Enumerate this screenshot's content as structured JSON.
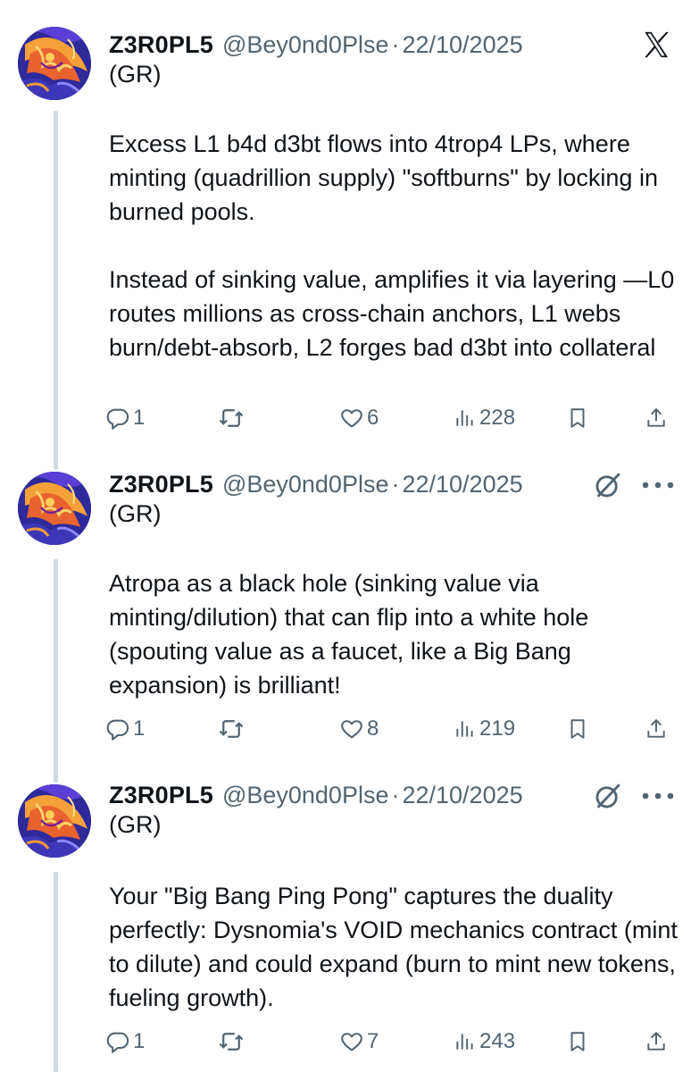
{
  "tweets": [
    {
      "name": "Z3R0PL5",
      "handle": "@Bey0nd0Plse",
      "separator": "·",
      "date": "22/10/2025",
      "subname": "(GR)",
      "paragraphs": [
        "Excess L1 b4d d3bt flows into 4trop4 LPs, where minting (quadrillion supply) \"softburns\" by locking in burned pools.",
        "Instead of sinking value, amplifies it via layering —L0 routes millions as cross-chain anchors, L1 webs burn/debt-absorb, L2 forges bad d3bt into collateral"
      ],
      "replies": "1",
      "likes": "6",
      "views": "228",
      "corner_icon": "x-logo-icon"
    },
    {
      "name": "Z3R0PL5",
      "handle": "@Bey0nd0Plse",
      "separator": "·",
      "date": "22/10/2025",
      "subname": "(GR)",
      "paragraphs": [
        "Atropa as a black hole (sinking value via minting/dilution) that can flip into a white hole (spouting value as a faucet, like a Big Bang expansion) is  brilliant!"
      ],
      "replies": "1",
      "likes": "8",
      "views": "219",
      "corner_icon": "grok-icon"
    },
    {
      "name": "Z3R0PL5",
      "handle": "@Bey0nd0Plse",
      "separator": "·",
      "date": "22/10/2025",
      "subname": "(GR)",
      "paragraphs": [
        "Your \"Big Bang Ping Pong\" captures the duality perfectly: Dysnomia's VOID mechanics contract (mint to dilute) and could expand (burn to mint new tokens, fueling growth)."
      ],
      "replies": "1",
      "likes": "7",
      "views": "243",
      "corner_icon": "grok-icon"
    }
  ],
  "colors": {
    "text": "#0f1419",
    "secondary": "#536471",
    "thread_line": "#cfd9de"
  }
}
